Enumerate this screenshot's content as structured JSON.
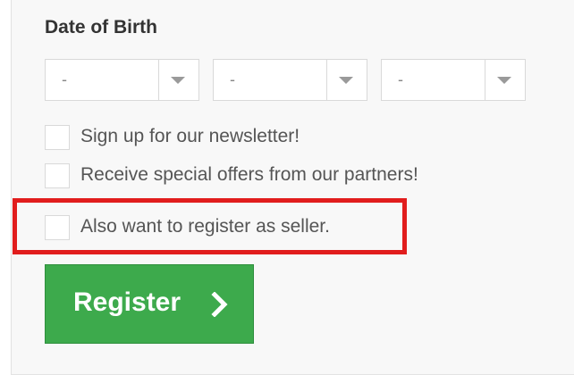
{
  "dob": {
    "label": "Date of Birth",
    "selects": [
      {
        "value": "-"
      },
      {
        "value": "-"
      },
      {
        "value": "-"
      }
    ]
  },
  "options": [
    {
      "label": "Sign up for our newsletter!",
      "checked": false
    },
    {
      "label": "Receive special offers from our partners!",
      "checked": false
    },
    {
      "label": "Also want to register as seller.",
      "checked": false
    }
  ],
  "register": {
    "label": "Register"
  },
  "icons": {
    "dropdown": "chevron-down-icon",
    "register": "chevron-right-icon"
  },
  "colors": {
    "button": "#3daa4c",
    "highlight": "#e11d1d"
  }
}
